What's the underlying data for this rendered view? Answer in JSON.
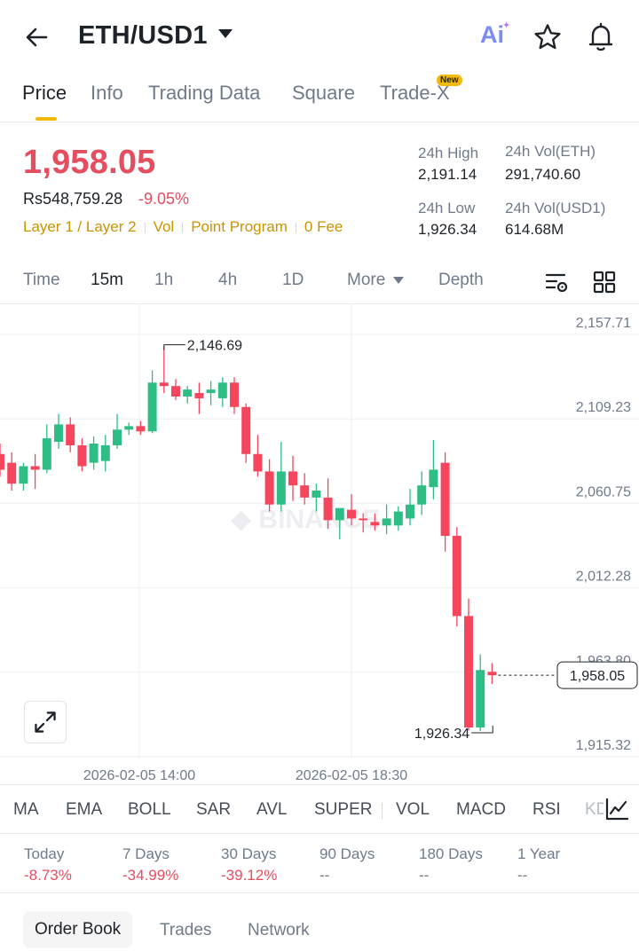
{
  "header": {
    "pair": "ETH/USD1",
    "ai_label": "Ai"
  },
  "tabs": [
    {
      "label": "Price"
    },
    {
      "label": "Info"
    },
    {
      "label": "Trading Data"
    },
    {
      "label": "Square"
    },
    {
      "label": "Trade-X"
    }
  ],
  "new_badge": "New",
  "ticker": {
    "last_price": "1,958.05",
    "fiat_price": "Rs548,759.28",
    "change": "-9.05%",
    "tags": [
      "Layer 1 / Layer 2",
      "Vol",
      "Point Program",
      "0 Fee"
    ]
  },
  "stats": {
    "high_label": "24h High",
    "high_value": "2,191.14",
    "vol_eth_label": "24h Vol(ETH)",
    "vol_eth_value": "291,740.60",
    "low_label": "24h Low",
    "low_value": "1,926.34",
    "vol_usd_label": "24h Vol(USD1)",
    "vol_usd_value": "614.68M"
  },
  "timeframes": [
    "Time",
    "15m",
    "1h",
    "4h",
    "1D",
    "More",
    "Depth"
  ],
  "active_timeframe": "15m",
  "chart_data": {
    "type": "candlestick",
    "interval": "15m",
    "y_ticks": [
      "2,157.71",
      "2,109.23",
      "2,060.75",
      "2,012.28",
      "1,963.80",
      "1,915.32"
    ],
    "ylim": [
      1915.32,
      2157.71
    ],
    "x_ticks": [
      "2026-02-05 14:00",
      "2026-02-05 18:30"
    ],
    "high_marker": "2,146.69",
    "low_marker": "1,926.34",
    "last_price_label": "1,958.05",
    "watermark": "BINANCE",
    "colors": {
      "up": "#2ebd85",
      "down": "#f6465d"
    },
    "candles": [
      {
        "o": 2085,
        "h": 2091,
        "l": 2072,
        "c": 2076
      },
      {
        "o": 2080,
        "h": 2086,
        "l": 2064,
        "c": 2068
      },
      {
        "o": 2068,
        "h": 2080,
        "l": 2064,
        "c": 2078
      },
      {
        "o": 2078,
        "h": 2085,
        "l": 2065,
        "c": 2076
      },
      {
        "o": 2076,
        "h": 2102,
        "l": 2074,
        "c": 2094
      },
      {
        "o": 2092,
        "h": 2108,
        "l": 2088,
        "c": 2102
      },
      {
        "o": 2102,
        "h": 2106,
        "l": 2086,
        "c": 2090
      },
      {
        "o": 2090,
        "h": 2094,
        "l": 2075,
        "c": 2078
      },
      {
        "o": 2080,
        "h": 2095,
        "l": 2076,
        "c": 2091
      },
      {
        "o": 2081,
        "h": 2096,
        "l": 2075,
        "c": 2090
      },
      {
        "o": 2090,
        "h": 2108,
        "l": 2088,
        "c": 2099
      },
      {
        "o": 2099,
        "h": 2103,
        "l": 2096,
        "c": 2101
      },
      {
        "o": 2101,
        "h": 2104,
        "l": 2096,
        "c": 2098
      },
      {
        "o": 2098,
        "h": 2133,
        "l": 2097,
        "c": 2126
      },
      {
        "o": 2126,
        "h": 2146.69,
        "l": 2120,
        "c": 2124
      },
      {
        "o": 2124,
        "h": 2128,
        "l": 2116,
        "c": 2118
      },
      {
        "o": 2118,
        "h": 2124,
        "l": 2114,
        "c": 2122
      },
      {
        "o": 2120,
        "h": 2126,
        "l": 2108,
        "c": 2117
      },
      {
        "o": 2120,
        "h": 2127,
        "l": 2113,
        "c": 2122
      },
      {
        "o": 2117,
        "h": 2129,
        "l": 2112,
        "c": 2126
      },
      {
        "o": 2126,
        "h": 2129,
        "l": 2108,
        "c": 2112
      },
      {
        "o": 2112,
        "h": 2114,
        "l": 2080,
        "c": 2085
      },
      {
        "o": 2085,
        "h": 2096,
        "l": 2072,
        "c": 2075
      },
      {
        "o": 2075,
        "h": 2082,
        "l": 2052,
        "c": 2056
      },
      {
        "o": 2056,
        "h": 2092,
        "l": 2052,
        "c": 2075
      },
      {
        "o": 2075,
        "h": 2084,
        "l": 2058,
        "c": 2067
      },
      {
        "o": 2067,
        "h": 2074,
        "l": 2056,
        "c": 2060
      },
      {
        "o": 2060,
        "h": 2068,
        "l": 2052,
        "c": 2064
      },
      {
        "o": 2060,
        "h": 2071,
        "l": 2042,
        "c": 2047
      },
      {
        "o": 2047,
        "h": 2052,
        "l": 2036,
        "c": 2054
      },
      {
        "o": 2053,
        "h": 2062,
        "l": 2044,
        "c": 2048
      },
      {
        "o": 2048,
        "h": 2051,
        "l": 2040,
        "c": 2047
      },
      {
        "o": 2046,
        "h": 2051,
        "l": 2041,
        "c": 2044
      },
      {
        "o": 2044,
        "h": 2056,
        "l": 2039,
        "c": 2048
      },
      {
        "o": 2044,
        "h": 2055,
        "l": 2041,
        "c": 2052
      },
      {
        "o": 2048,
        "h": 2065,
        "l": 2044,
        "c": 2056
      },
      {
        "o": 2056,
        "h": 2075,
        "l": 2050,
        "c": 2067
      },
      {
        "o": 2066,
        "h": 2093,
        "l": 2059,
        "c": 2076
      },
      {
        "o": 2080,
        "h": 2086,
        "l": 2029,
        "c": 2038
      },
      {
        "o": 2038,
        "h": 2043,
        "l": 1986,
        "c": 1992
      },
      {
        "o": 1992,
        "h": 2002,
        "l": 1926.34,
        "c": 1928
      },
      {
        "o": 1928,
        "h": 1970,
        "l": 1926,
        "c": 1961
      },
      {
        "o": 1960,
        "h": 1965,
        "l": 1953,
        "c": 1958.05
      }
    ]
  },
  "indicators": [
    "MA",
    "EMA",
    "BOLL",
    "SAR",
    "AVL",
    "SUPER",
    "VOL",
    "MACD",
    "RSI",
    "KDJ"
  ],
  "performance": [
    {
      "label": "Today",
      "value": "-8.73%",
      "tone": "down"
    },
    {
      "label": "7 Days",
      "value": "-34.99%",
      "tone": "down"
    },
    {
      "label": "30 Days",
      "value": "-39.12%",
      "tone": "down"
    },
    {
      "label": "90 Days",
      "value": "--",
      "tone": "none"
    },
    {
      "label": "180 Days",
      "value": "--",
      "tone": "none"
    },
    {
      "label": "1 Year",
      "value": "--",
      "tone": "none"
    }
  ],
  "bottom_tabs": [
    "Order Book",
    "Trades",
    "Network"
  ],
  "icons": {
    "back": "arrow-left-icon",
    "ai": "ai-icon",
    "favorite": "star-icon",
    "alerts": "bell-icon",
    "chart_settings": "chart-settings-icon",
    "layout": "grid-icon",
    "expand": "expand-icon",
    "indicator_settings": "indicator-chart-icon"
  }
}
